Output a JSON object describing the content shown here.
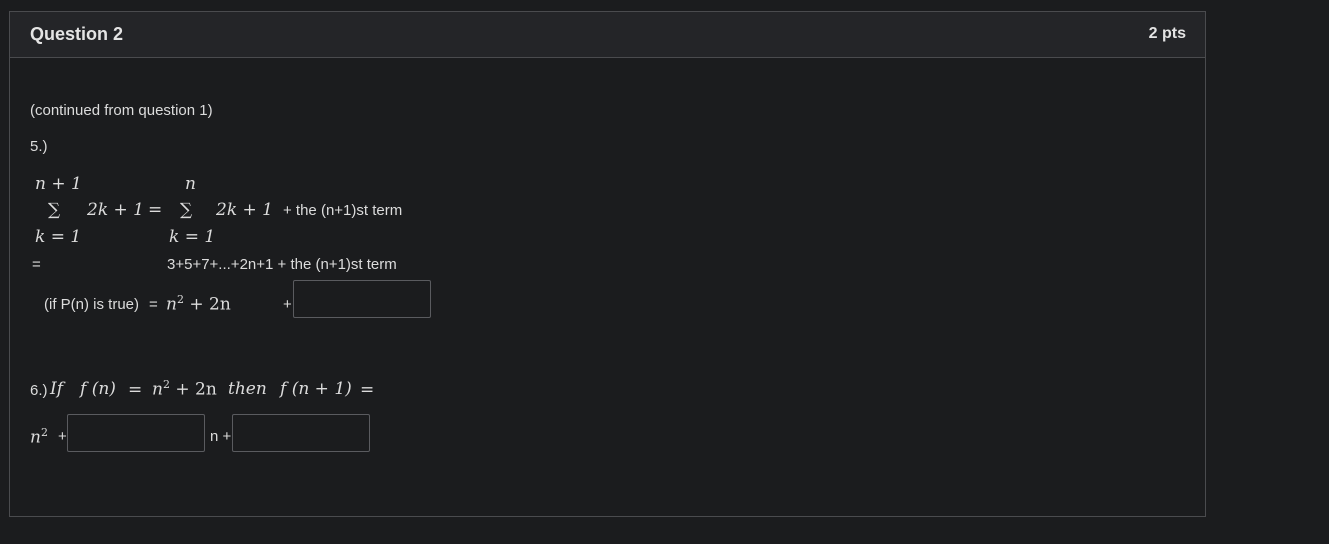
{
  "question": {
    "title": "Question 2",
    "points": "2 pts",
    "intro": "(continued from question 1)",
    "part5": {
      "label": "5.)",
      "sum_left_top": "n + 1",
      "sum_left_bottom": "k = 1",
      "sum_symbol": "∑",
      "sum_term_left": "2k + 1",
      "equals": "=",
      "sum_right_top": "n",
      "sum_right_bottom": "k = 1",
      "sum_term_right": "2k + 1",
      "next_term_text_1": "+ the (n+1)st term",
      "line2_equals": "=",
      "line2_expr": "3+5+7+...+2n+1 + the (n+1)st term",
      "line3_condition": "(if P(n) is true)",
      "line3_equals": "=",
      "line3_expr_base": "n",
      "line3_expr_exp": "2",
      "line3_expr_rest": "+ 2n",
      "line3_plus": "+",
      "answer1_value": ""
    },
    "part6": {
      "label": "6.)",
      "if_text": "If",
      "f_n": "f (n)",
      "equals": "=",
      "expr_base": "n",
      "expr_exp": "2",
      "expr_rest": "+ 2n",
      "then_text": "then",
      "f_n1": "f (n + 1)",
      "equals2": "=",
      "ans_base": "n",
      "ans_exp": "2",
      "plus1": "+",
      "n_plus": "n +",
      "answer2_value": "",
      "answer3_value": ""
    }
  }
}
